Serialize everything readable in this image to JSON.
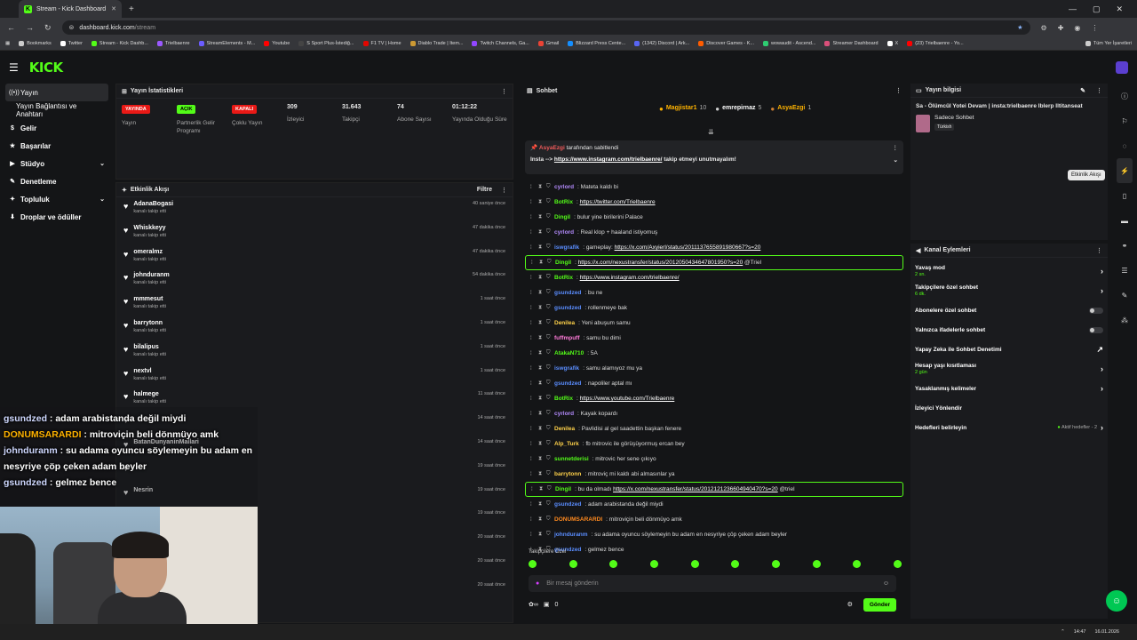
{
  "browser": {
    "tab_title": "Stream - Kick Dashboard",
    "url_host": "dashboard.kick.com",
    "url_path": "/stream",
    "bookmarks": [
      "Bookmarks",
      "Twitter",
      "Stream - Kick Dashb...",
      "Trielbaenre",
      "StreamElements - M...",
      "Youtube",
      "S Sport Plus-İstediğ...",
      "F1 TV | Home",
      "Diablo Trade | Item...",
      "Twitch Channels, Ga...",
      "Gmail",
      "Blizzard Press Cente...",
      "(1342) Discord | Ark...",
      "Discover Games - K...",
      "wowaudit - Ascend...",
      "Streamer Dashboard",
      "X",
      "(23) Trielbaenre - Yo...",
      "Tüm Yer İşaretleri"
    ]
  },
  "logo": "KICK",
  "sidebar": {
    "items": [
      {
        "label": "Yayın",
        "active": true
      },
      {
        "label": "Yayın Bağlantısı ve Anahtarı",
        "sub": true
      },
      {
        "label": "Gelir"
      },
      {
        "label": "Başarılar"
      },
      {
        "label": "Stüdyo"
      },
      {
        "label": "Denetleme"
      },
      {
        "label": "Topluluk"
      },
      {
        "label": "Droplar ve ödüller"
      }
    ]
  },
  "stats": {
    "title": "Yayın İstatistikleri",
    "items": [
      {
        "badge": "YAYINDA",
        "label": "Yayın"
      },
      {
        "badge": "AÇIK",
        "label": "Partnerlik Gelir Programı"
      },
      {
        "badge": "KAPALI",
        "label": "Çoklu Yayın"
      },
      {
        "value": "309",
        "label": "İzleyici"
      },
      {
        "value": "31.643",
        "label": "Takipçi"
      },
      {
        "value": "74",
        "label": "Abone Sayısı"
      },
      {
        "value": "01:12:22",
        "label": "Yayında Olduğu Süre"
      }
    ]
  },
  "activity": {
    "title": "Etkinlik Akışı",
    "filter": "Filtre",
    "rows": [
      {
        "name": "AdanaBogasi",
        "sub": "kanalı takip etti",
        "time": "40 saniye önce"
      },
      {
        "name": "Whiskkeyy",
        "sub": "kanalı takip etti",
        "time": "47 dakika önce"
      },
      {
        "name": "omeralmz",
        "sub": "kanalı takip etti",
        "time": "47 dakika önce"
      },
      {
        "name": "johnduranm",
        "sub": "kanalı takip etti",
        "time": "54 dakika önce"
      },
      {
        "name": "mmmesut",
        "sub": "kanalı takip etti",
        "time": "1 saat önce"
      },
      {
        "name": "barrytonn",
        "sub": "kanalı takip etti",
        "time": "1 saat önce"
      },
      {
        "name": "bilalipus",
        "sub": "kanalı takip etti",
        "time": "1 saat önce"
      },
      {
        "name": "nextvl",
        "sub": "kanalı takip etti",
        "time": "1 saat önce"
      },
      {
        "name": "halmege",
        "sub": "kanalı takip etti",
        "time": "11 saat önce"
      },
      {
        "name": "",
        "sub": "",
        "time": "14 saat önce"
      },
      {
        "name": "BatanDunyaninMallari",
        "sub": "",
        "time": "14 saat önce"
      },
      {
        "name": "",
        "sub": "",
        "time": "19 saat önce"
      },
      {
        "name": "Nesrin",
        "sub": "",
        "time": "19 saat önce"
      },
      {
        "name": "",
        "sub": "",
        "time": "19 saat önce"
      },
      {
        "name": "",
        "sub": "",
        "time": "20 saat önce"
      },
      {
        "name": "",
        "sub": "",
        "time": "20 saat önce"
      },
      {
        "name": "",
        "sub": "",
        "time": "20 saat önce"
      }
    ]
  },
  "overlay": [
    {
      "user": "gsundzed",
      "text": " : adam arabistanda değil miydi",
      "gold": false
    },
    {
      "user": "DONUMSARARDI",
      "text": " : mitroviçin beli dönmüyo amk",
      "gold": true
    },
    {
      "user": "johnduranm",
      "text": " : su adama oyuncu söylemeyin bu adam en nesyriye çöp çeken adam beyler",
      "gold": false
    },
    {
      "user": "gsundzed",
      "text": " : gelmez bence",
      "gold": false
    }
  ],
  "chat": {
    "title": "Sohbet",
    "leaders": [
      {
        "name": "Magjistar1",
        "count": "10"
      },
      {
        "name": "emrepirnaz",
        "count": "5"
      },
      {
        "name": "AsyaEzgi",
        "count": "1"
      }
    ],
    "pin": {
      "user": "AsyaEzgi",
      "by": "tarafından sabitlendi",
      "prefix": "Insta --> ",
      "link": "https://www.instagram.com/trielbaenre/",
      "suffix": " takip etmeyi unutmayalım!"
    },
    "messages": [
      {
        "user": "cyrlord",
        "color": "#b58cff",
        "text": "Mateta kaldı bi",
        "link": ""
      },
      {
        "user": "BotRix",
        "color": "#53fc18",
        "text": "",
        "link": "https://twitter.com/Trielbaenre"
      },
      {
        "user": "Dingil",
        "color": "#53fc18",
        "text": "bulur yine birilerini Palace",
        "link": ""
      },
      {
        "user": "cyrlord",
        "color": "#b58cff",
        "text": "Real klop + haaland istiyomuş",
        "link": ""
      },
      {
        "user": "iswgrafik",
        "color": "#5a8dff",
        "text": "gameplay: ",
        "link": "https://x.com/Axyierl/status/2011137655891980667?s=20"
      },
      {
        "user": "Dingil",
        "color": "#53fc18",
        "text": "",
        "link": "https://x.com/nexustransfer/status/2012050434647801950?s=20",
        "after": " @Triel",
        "hl": true
      },
      {
        "user": "BotRix",
        "color": "#53fc18",
        "text": "",
        "link": "https://www.instagram.com/trielbaenre/"
      },
      {
        "user": "gsundzed",
        "color": "#5a8dff",
        "text": "bu ne",
        "link": ""
      },
      {
        "user": "gsundzed",
        "color": "#5a8dff",
        "text": "rollenmeye bak",
        "link": ""
      },
      {
        "user": "Denilea",
        "color": "#ffd24a",
        "text": "Yeni abuşum samu",
        "link": ""
      },
      {
        "user": "fuffmpuff",
        "color": "#ff7ad9",
        "text": "samu bu dimi",
        "link": ""
      },
      {
        "user": "AtakaN710",
        "color": "#53fc18",
        "text": "5A",
        "link": ""
      },
      {
        "user": "iswgrafik",
        "color": "#5a8dff",
        "text": "samu alamıyoz mu ya",
        "link": ""
      },
      {
        "user": "gsundzed",
        "color": "#5a8dff",
        "text": "napoliler aptal mı",
        "link": ""
      },
      {
        "user": "BotRix",
        "color": "#53fc18",
        "text": "",
        "link": "https://www.youtube.com/Trielbaenre"
      },
      {
        "user": "cyrlord",
        "color": "#b58cff",
        "text": "Kayak kopardı",
        "link": ""
      },
      {
        "user": "Denilea",
        "color": "#ffd24a",
        "text": "Pavlidisi al gel saadettin başkan fenere",
        "link": ""
      },
      {
        "user": "Alp_Turk",
        "color": "#ffd24a",
        "text": "fb mitrovic ile görüşüyormuş ercan bey",
        "link": ""
      },
      {
        "user": "sunnetderisi",
        "color": "#53fc18",
        "text": "mitrovic her sene çıkıyo",
        "link": ""
      },
      {
        "user": "barrytonn",
        "color": "#ffd24a",
        "text": "mitroviç mi kaldı abi almasınlar ya",
        "link": ""
      },
      {
        "user": "Dingil",
        "color": "#53fc18",
        "text": "bu da olmadı ",
        "link": "https://x.com/nexustransfer/status/2012121236604940470?s=20",
        "after": " @triel",
        "hl": true
      },
      {
        "user": "gsundzed",
        "color": "#5a8dff",
        "text": "adam arabistanda değil miydi",
        "link": ""
      },
      {
        "user": "DONUMSARARDI",
        "color": "#ff8a1f",
        "text": "mitroviçin beli dönmüyo amk",
        "link": ""
      },
      {
        "user": "johnduranm",
        "color": "#5a8dff",
        "text": "su adama oyuncu söylemeyin bu adam en nesyriye çöp çeken adam beyler",
        "link": ""
      },
      {
        "user": "gsundzed",
        "color": "#5a8dff",
        "text": "gelmez bence",
        "link": ""
      }
    ],
    "followers_only": "Takipçilere Özel",
    "placeholder": "Bir mesaj gönderin",
    "count": "0",
    "send": "Gönder"
  },
  "stream_info": {
    "title": "Yayın bilgisi",
    "stream_title": "Sa - Ölümcül Yotei Devam | insta:trielbaenre Iblerp Iltitanseat",
    "category": "Sadece Sohbet",
    "tag": "Türkish"
  },
  "channel": {
    "title": "Kanal Eylemleri",
    "rows": [
      {
        "label": "Yavaş mod",
        "sub": "2 sn.",
        "kind": "chev"
      },
      {
        "label": "Takipçilere özel sohbet",
        "sub": "6 dk.",
        "kind": "chev"
      },
      {
        "label": "Abonelere özel sohbet",
        "sub": "",
        "kind": "toggle"
      },
      {
        "label": "Yalnızca ifadelerle sohbet",
        "sub": "",
        "kind": "toggle"
      },
      {
        "label": "Yapay Zeka ile Sohbet Denetimi",
        "sub": "",
        "kind": "ext"
      },
      {
        "label": "Hesap yaşı kısıtlaması",
        "sub": "2 gün",
        "kind": "chev"
      },
      {
        "label": "Yasaklanmış kelimeler",
        "sub": "",
        "kind": "chev"
      },
      {
        "label": "İzleyici Yönlendir",
        "sub": "",
        "kind": "none"
      },
      {
        "label": "Hedefleri belirleyin",
        "sub": "",
        "kind": "goal",
        "extra": "Aktif hedefler - 2"
      }
    ]
  },
  "tooltip": "Etkinlik Akışı",
  "taskbar": {
    "time": "14:47",
    "date": "16.01.2026"
  }
}
